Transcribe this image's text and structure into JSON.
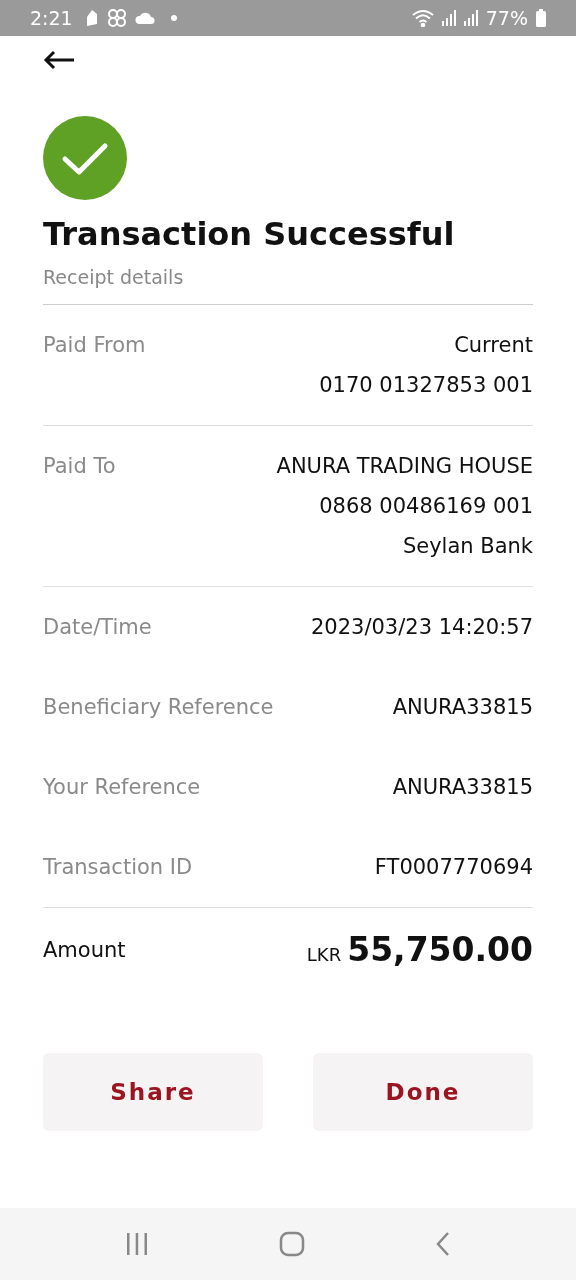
{
  "status_bar": {
    "time": "2:21",
    "battery": "77%"
  },
  "title": "Transaction Successful",
  "subtitle": "Receipt details",
  "sections": [
    {
      "rows": [
        {
          "label": "Paid From",
          "values": [
            "Current",
            "0170 01327853 001"
          ]
        }
      ]
    },
    {
      "rows": [
        {
          "label": "Paid To",
          "values": [
            "ANURA TRADING HOUSE",
            "0868 00486169 001",
            "Seylan Bank"
          ]
        }
      ]
    },
    {
      "rows": [
        {
          "label": "Date/Time",
          "values": [
            "2023/03/23 14:20:57"
          ]
        },
        {
          "label": "Beneficiary Reference",
          "values": [
            "ANURA33815"
          ]
        },
        {
          "label": "Your Reference",
          "values": [
            "ANURA33815"
          ]
        },
        {
          "label": "Transaction ID",
          "values": [
            "FT0007770694"
          ]
        }
      ]
    }
  ],
  "amount": {
    "label": "Amount",
    "currency": "LKR",
    "value": "55,750.00"
  },
  "buttons": [
    "Share",
    "Done"
  ]
}
